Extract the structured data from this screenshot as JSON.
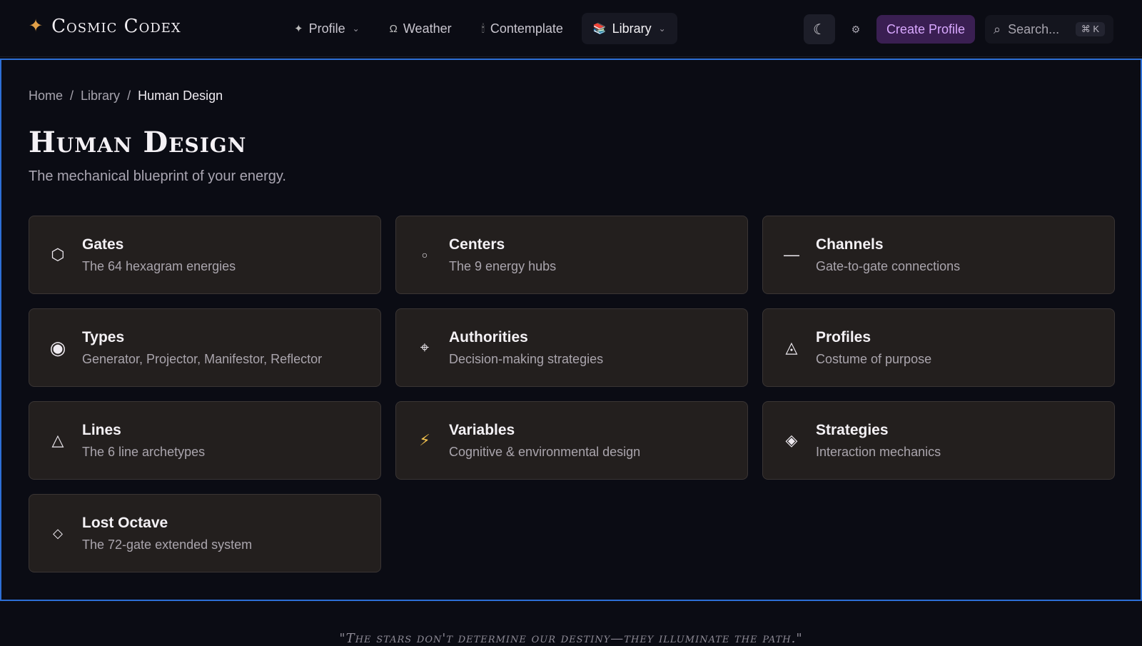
{
  "brand": {
    "name": "Cosmic Codex",
    "icon": "sparkle-icon"
  },
  "nav": {
    "items": [
      {
        "label": "Profile",
        "icon": "sparkle-icon",
        "dropdown": true
      },
      {
        "label": "Weather",
        "icon": "omega-icon",
        "dropdown": false
      },
      {
        "label": "Contemplate",
        "icon": "candle-icon",
        "dropdown": false
      },
      {
        "label": "Library",
        "icon": "books-icon",
        "dropdown": true,
        "active": true
      }
    ]
  },
  "header_right": {
    "theme_icon": "moon-icon",
    "settings_icon": "gear-icon",
    "create_label": "Create Profile",
    "search_placeholder": "Search...",
    "shortcut": "⌘ K"
  },
  "breadcrumb": {
    "items": [
      "Home",
      "Library"
    ],
    "current": "Human Design",
    "separator": "/"
  },
  "page": {
    "title": "Human Design",
    "subtitle": "The mechanical blueprint of your energy."
  },
  "cards": [
    {
      "name": "Gates",
      "desc": "The 64 hexagram energies",
      "icon": "hexagon-icon"
    },
    {
      "name": "Centers",
      "desc": "The 9 energy hubs",
      "icon": "circle-icon"
    },
    {
      "name": "Channels",
      "desc": "Gate-to-gate connections",
      "icon": "line-icon"
    },
    {
      "name": "Types",
      "desc": "Generator, Projector, Manifestor, Reflector",
      "icon": "radio-circle-icon"
    },
    {
      "name": "Authorities",
      "desc": "Decision-making strategies",
      "icon": "crosshair-icon"
    },
    {
      "name": "Profiles",
      "desc": "Costume of purpose",
      "icon": "triangle-eye-icon"
    },
    {
      "name": "Lines",
      "desc": "The 6 line archetypes",
      "icon": "triangle-icon"
    },
    {
      "name": "Variables",
      "desc": "Cognitive & environmental design",
      "icon": "lightning-icon"
    },
    {
      "name": "Strategies",
      "desc": "Interaction mechanics",
      "icon": "diamond-filled-icon"
    },
    {
      "name": "Lost Octave",
      "desc": "The 72-gate extended system",
      "icon": "diamond-outline-icon"
    }
  ],
  "footer": {
    "quote": "\"The stars don't determine our destiny—they illuminate the path.\""
  },
  "colors": {
    "accent_border": "#2d6fd6",
    "create_bg": "#3a1f52",
    "create_text": "#d9a8ff",
    "brand_star": "#e2a048"
  }
}
